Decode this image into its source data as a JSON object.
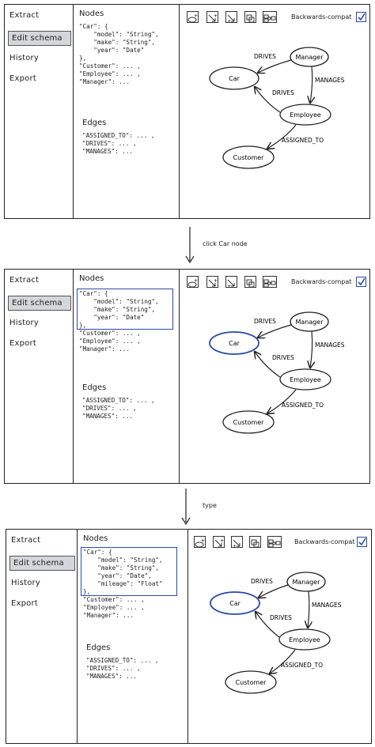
{
  "sidebar": {
    "items": [
      {
        "label": "Extract",
        "active": false
      },
      {
        "label": "Edit schema",
        "active": true
      },
      {
        "label": "History",
        "active": false
      },
      {
        "label": "Export",
        "active": false
      }
    ]
  },
  "toolbar": {
    "tools": [
      "add-node-tool-icon",
      "add-edge-tool-icon",
      "add-edge-alt-tool-icon",
      "group-tool-icon",
      "layout-tool-icon"
    ],
    "compat_label": "Backwards-compat",
    "compat_checked": true
  },
  "colors": {
    "highlight": "#2a4aa8",
    "active_nav": "#d3d6db",
    "ink": "#222222"
  },
  "panels": [
    {
      "nodes_title": "Nodes",
      "nodes_code": "\"Car\": {\n    \"model\": \"String\",\n    \"make\": \"String\",\n    \"year\": \"Date\"\n},\n\"Customer\": ... ,\n\"Employee\": ... ,\n\"Manager\": ...",
      "edges_title": "Edges",
      "edges_code": "\"ASSIGNED_TO\": ... ,\n\"DRIVES\": ... ,\n\"MANAGES\": ...",
      "car_selected": false,
      "car_block_highlighted": false
    },
    {
      "nodes_title": "Nodes",
      "nodes_code": "\"Car\": {\n    \"model\": \"String\",\n    \"make\": \"String\",\n    \"year\": \"Date\"\n},\n\"Customer\": ... ,\n\"Employee\": ... ,\n\"Manager\": ...",
      "edges_title": "Edges",
      "edges_code": "\"ASSIGNED_TO\": ... ,\n\"DRIVES\": ... ,\n\"MANAGES\": ...",
      "car_selected": true,
      "car_block_highlighted": true
    },
    {
      "nodes_title": "Nodes",
      "nodes_code": "\"Car\": {\n    \"model\": \"String\",\n    \"make\": \"String\",\n    \"year\": \"Date\",\n    \"mileage\": \"Float\"\n},\n\"Customer\": ... ,\n\"Employee\": ... ,\n\"Manager\": ...",
      "edges_title": "Edges",
      "edges_code": "\"ASSIGNED_TO\": ... ,\n\"DRIVES\": ... ,\n\"MANAGES\": ...",
      "car_selected": true,
      "car_block_highlighted": true
    }
  ],
  "graph": {
    "nodes": {
      "manager": "Manager",
      "car": "Car",
      "employee": "Employee",
      "customer": "Customer"
    },
    "edges": {
      "drives_top": "DRIVES",
      "drives_mid": "DRIVES",
      "manages": "MANAGES",
      "assigned_to": "ASSIGNED_TO"
    }
  },
  "steps": [
    "click Car node",
    "type"
  ]
}
